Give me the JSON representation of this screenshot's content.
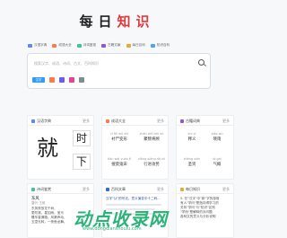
{
  "logo": {
    "part1": "每日",
    "part2": "知识"
  },
  "nav": [
    {
      "label": "汉语字典",
      "color": "#5b87ff"
    },
    {
      "label": "成语大全",
      "color": "#ff7a45"
    },
    {
      "label": "诗词鉴赏",
      "color": "#36c79b"
    },
    {
      "label": "古籍文献",
      "color": "#9254de"
    },
    {
      "label": "每日百科",
      "color": "#f5a623"
    },
    {
      "label": "知识百科",
      "color": "#4aa3ff"
    }
  ],
  "search": {
    "placeholder": "搜索汉字、成语、诗词、古文、百科知识",
    "quick_colors": [
      "#2f9cf5",
      "#ff7a45",
      "#6c5ce7",
      "#e84393",
      "#7f8c8d"
    ],
    "quick_label": "汉字"
  },
  "dict": {
    "title": "汉语字典",
    "more": "更多",
    "big": "就",
    "small1": "时",
    "small2": "下"
  },
  "idiom": {
    "title": "成语大全",
    "more": "更多",
    "cells": [
      {
        "py": "cì fēi wú zhī",
        "w": "衬尸变形"
      },
      {
        "py": "zhǎn wéi rén xū",
        "w": "聚叛将顾"
      },
      {
        "py": "tiān wài yuán ě",
        "w": "搜莫鬼宋"
      },
      {
        "py": "xiāng xiāng dǎ xǔ",
        "w": "行进攻势"
      }
    ]
  },
  "poem": {
    "title": "古籍词典",
    "more": "更多",
    "cells": [
      {
        "py": "shì yì",
        "w": "释义"
      },
      {
        "py": "xiǎo wú",
        "w": "晓雨"
      },
      {
        "py": "shèng xián",
        "w": "圣贤"
      },
      {
        "py": "qì gài",
        "w": "气概"
      }
    ]
  },
  "recommend": {
    "title": "诗词鉴赏",
    "more": "更多",
    "author": "东风",
    "dynasty": "唐代·王维",
    "lines": [
      "东风夜放花千树，",
      "更吹落，星如雨。宝马",
      "雕车香满路。凤箫声动，",
      "玉壶光转，一夜鱼龙舞。"
    ]
  },
  "news": {
    "title": "百科文章",
    "more": "更多",
    "headline": "汉字\"认\"的写法、意义演变中十二码..."
  },
  "daily": {
    "title": "每日知识",
    "more": "更多",
    "lines": [
      "5. 在\"汉字\"中\"新\"字的部首",
      "有人\"学问\"是指向得学习的",
      "关系\"学问\"与\"知识\"区别",
      "\"学而\"是解释的对问题",
      "各种文的意义与分析说明"
    ]
  },
  "watermark": {
    "text": "动点收录网",
    "url": "www.dongdianshoulu.com"
  }
}
